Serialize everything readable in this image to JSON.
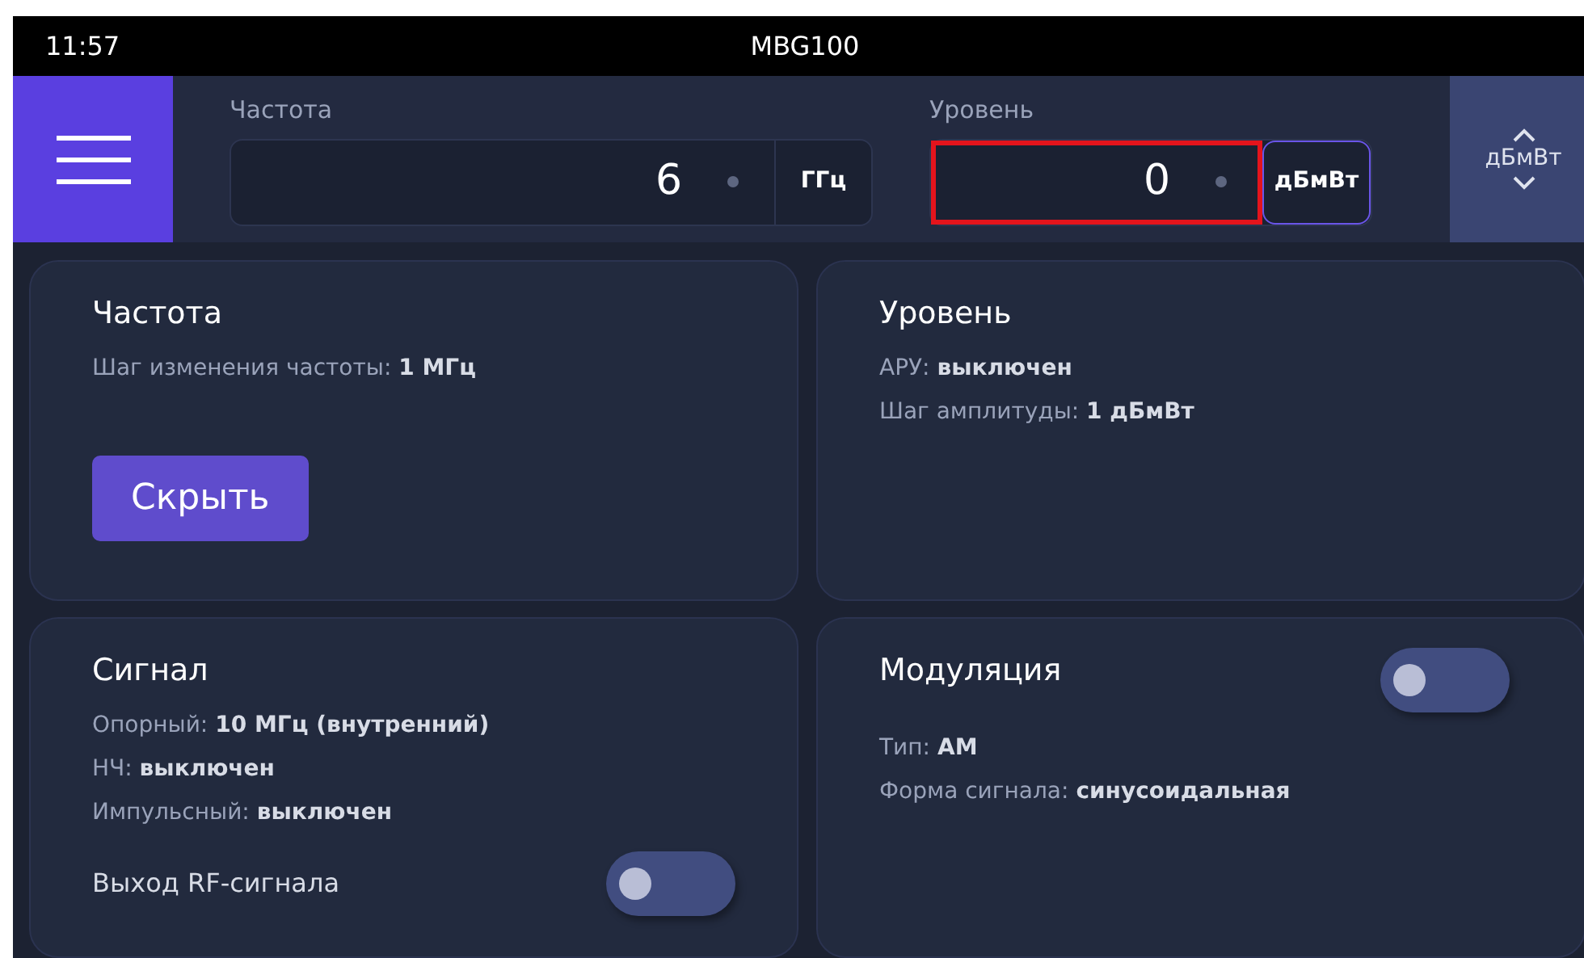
{
  "status_bar": {
    "time": "11:57",
    "title": "MBG100"
  },
  "header": {
    "fields": [
      {
        "label": "Частота",
        "value": "6",
        "unit": "ГГц",
        "focused": false,
        "highlighted": false
      },
      {
        "label": "Уровень",
        "value": "0",
        "unit": "дБмВт",
        "focused": true,
        "highlighted": true
      }
    ],
    "unit_switch": {
      "label": "дБмВт"
    }
  },
  "cards": [
    {
      "title": "Частота",
      "lines": [
        "Шаг изменения частоты: **1 МГц**"
      ],
      "button": "Скрыть"
    },
    {
      "title": "Уровень",
      "lines": [
        "АРУ: **выключен**",
        "Шаг амплитуды: **1 дБмВт**"
      ]
    },
    {
      "title": "Сигнал",
      "lines": [
        "Опорный: **10 МГц (внутренний)**",
        "НЧ: **выключен**",
        "Импульсный: **выключен**"
      ],
      "switch": {
        "label": "Выход RF-сигнала",
        "on": false,
        "kind": "row"
      }
    },
    {
      "title": "Модуляция",
      "lines": [
        "Тип: **АМ**",
        "Форма сигнала: **синусоидальная**"
      ],
      "switch": {
        "on": false,
        "kind": "corner"
      }
    }
  ]
}
